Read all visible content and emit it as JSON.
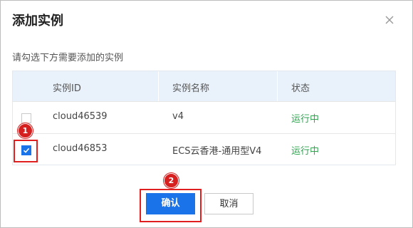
{
  "dialog": {
    "title": "添加实例",
    "subtitle": "请勾选下方需要添加的实例"
  },
  "table": {
    "headers": {
      "id": "实例ID",
      "name": "实例名称",
      "status": "状态"
    },
    "rows": [
      {
        "id": "cloud46539",
        "name": "v4",
        "status": "运行中",
        "checked": false
      },
      {
        "id": "cloud46853",
        "name": "ECS云香港-通用型V4",
        "status": "运行中",
        "checked": true
      }
    ]
  },
  "annotations": {
    "step1": "1",
    "step2": "2"
  },
  "buttons": {
    "confirm": "确认",
    "cancel": "取消"
  },
  "colors": {
    "primary": "#1a73e8",
    "status_running": "#2ea44f",
    "annotation_red": "#e02020",
    "header_bg": "#e9f1fb"
  },
  "icons": {
    "close": "close-icon",
    "check": "check-icon"
  }
}
